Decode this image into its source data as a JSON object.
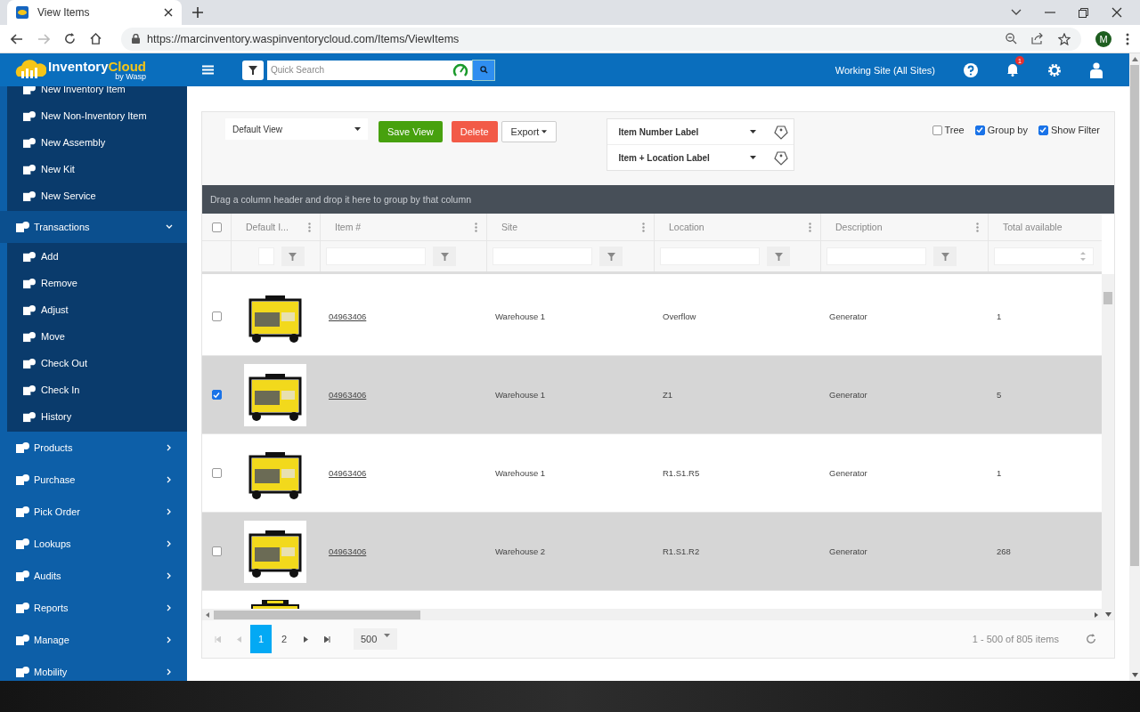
{
  "browser": {
    "tab_title": "View Items",
    "url": "https://marcinventory.waspinventorycloud.com/Items/ViewItems",
    "avatar": "M"
  },
  "header": {
    "logo_word_1": "Inventory",
    "logo_word_2": "Cloud",
    "logo_tagline": "by Wasp",
    "search": {
      "placeholder": "Quick Search"
    },
    "working_site": "Working Site (All Sites)",
    "notification_count": "1"
  },
  "sidebar": {
    "items": [
      {
        "expanded": true,
        "children": [
          {
            "label": "New Inventory Item"
          },
          {
            "label": "New Non-Inventory Item"
          },
          {
            "label": "New Assembly"
          },
          {
            "label": "New Kit"
          },
          {
            "label": "New Service"
          }
        ]
      },
      {
        "label": "Transactions",
        "expanded": true,
        "children": [
          {
            "label": "Add"
          },
          {
            "label": "Remove"
          },
          {
            "label": "Adjust"
          },
          {
            "label": "Move"
          },
          {
            "label": "Check Out"
          },
          {
            "label": "Check In"
          },
          {
            "label": "History"
          }
        ]
      },
      {
        "label": "Products",
        "expanded": false
      },
      {
        "label": "Purchase",
        "expanded": false
      },
      {
        "label": "Pick Order",
        "expanded": false
      },
      {
        "label": "Lookups",
        "expanded": false
      },
      {
        "label": "Audits",
        "expanded": false
      },
      {
        "label": "Reports",
        "expanded": false
      },
      {
        "label": "Manage",
        "expanded": false
      },
      {
        "label": "Mobility",
        "expanded": false
      }
    ]
  },
  "toolbar": {
    "view": "Default View",
    "buttons": [
      {
        "label": "Save View",
        "kind": "save"
      },
      {
        "label": "Delete",
        "kind": "delete"
      },
      {
        "label": "Export",
        "kind": "menu"
      }
    ],
    "labels": [
      "Item Number Label",
      "Item + Location Label"
    ],
    "options": [
      {
        "label": "Tree",
        "checked": false
      },
      {
        "label": "Group by",
        "checked": true
      },
      {
        "label": "Show Filter",
        "checked": true
      }
    ]
  },
  "group_panel": "Drag a column header and drop it here to group by that column",
  "table": {
    "select_all": {
      "checked": false
    },
    "columns": [
      "Default I...",
      "Item #",
      "Site",
      "Location",
      "Description",
      "Total available"
    ],
    "rows": [
      {
        "checked": false,
        "item": "04963406",
        "site": "Warehouse 1",
        "location": "Overflow",
        "description": "Generator",
        "total": "1"
      },
      {
        "checked": true,
        "item": "04963406",
        "site": "Warehouse 1",
        "location": "Z1",
        "description": "Generator",
        "total": "5"
      },
      {
        "checked": false,
        "item": "04963406",
        "site": "Warehouse 1",
        "location": "R1.S1.R5",
        "description": "Generator",
        "total": "1"
      },
      {
        "checked": false,
        "item": "04963406",
        "site": "Warehouse 2",
        "location": "R1.S1.R2",
        "description": "Generator",
        "total": "268"
      }
    ],
    "partial_rows": [
      {
        "kind": "picture"
      }
    ]
  },
  "pager": {
    "pages": [
      {
        "label": "1",
        "selected": true
      },
      {
        "label": "2",
        "selected": false
      }
    ],
    "page_size": "500",
    "info": "1 - 500 of 805 items"
  }
}
